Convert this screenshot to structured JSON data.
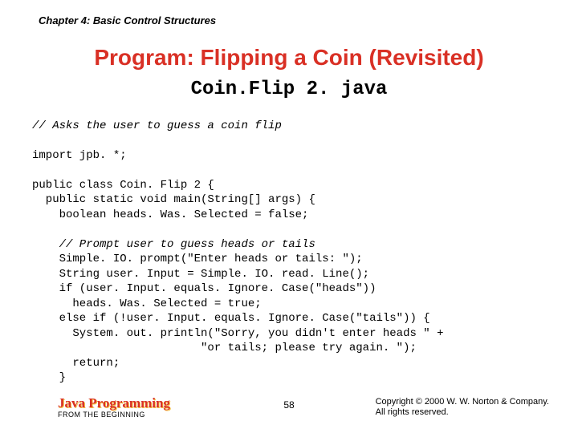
{
  "chapter": "Chapter 4: Basic Control Structures",
  "title": "Program: Flipping a Coin (Revisited)",
  "subtitle": "Coin.Flip 2. java",
  "code": {
    "c1": "// Asks the user to guess a coin flip",
    "l2": "import jpb. *;",
    "l3": "public class Coin. Flip 2 {",
    "l4": "  public static void main(String[] args) {",
    "l5": "    boolean heads. Was. Selected = false;",
    "c2": "    // Prompt user to guess heads or tails",
    "l6": "    Simple. IO. prompt(\"Enter heads or tails: \");",
    "l7": "    String user. Input = Simple. IO. read. Line();",
    "l8": "    if (user. Input. equals. Ignore. Case(\"heads\"))",
    "l9": "      heads. Was. Selected = true;",
    "l10": "    else if (!user. Input. equals. Ignore. Case(\"tails\")) {",
    "l11": "      System. out. println(\"Sorry, you didn't enter heads \" +",
    "l12": "                         \"or tails; please try again. \");",
    "l13": "      return;",
    "l14": "    }"
  },
  "footer": {
    "brand": "Java Programming",
    "subbrand": "FROM THE BEGINNING",
    "page": "58",
    "copyright1": "Copyright © 2000 W. W. Norton & Company.",
    "copyright2": "All rights reserved."
  }
}
